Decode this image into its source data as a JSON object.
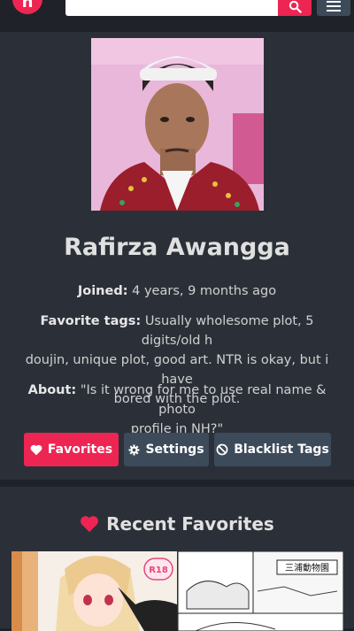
{
  "header": {
    "logo_text": "n",
    "search_placeholder": "",
    "search_icon": "search-icon",
    "menu_icon": "menu-icon",
    "brand_color": "#ed2553"
  },
  "profile": {
    "username": "Rafirza Awangga",
    "joined_label": "Joined:",
    "joined_value": "4 years, 9 months ago",
    "favorite_tags_label": "Favorite tags:",
    "favorite_tags_line1": "Usually wholesome plot, 5 digits/old h",
    "favorite_tags_line2": "doujin, unique plot, good art. NTR is okay, but i have",
    "favorite_tags_line3": "bored with the plot.",
    "about_label": "About:",
    "about_line1": "\"Is it wrong for me to use real name & photo",
    "about_line2": "profile in NH?\""
  },
  "actions": {
    "favorites_label": "Favorites",
    "settings_label": "Settings",
    "blacklist_label": "Blacklist Tags"
  },
  "recent": {
    "heading": "Recent Favorites",
    "thumb1_badge": "R18",
    "thumb2_sign": "三浦動物園"
  }
}
